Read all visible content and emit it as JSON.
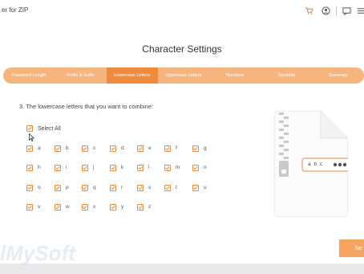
{
  "window": {
    "title": "er for ZIP"
  },
  "titlebar": {
    "icons": [
      "cart-icon",
      "user-icon",
      "feedback-icon",
      "menu-icon"
    ]
  },
  "heading": "Character Settings",
  "tabs": [
    {
      "label": "Password Length",
      "active": false
    },
    {
      "label": "Prefix & Suffix",
      "active": false
    },
    {
      "label": "Lowercase Letters",
      "active": true
    },
    {
      "label": "Uppercase Letters",
      "active": false
    },
    {
      "label": "Numbers",
      "active": false
    },
    {
      "label": "Symbols",
      "active": false
    },
    {
      "label": "Summary",
      "active": false
    }
  ],
  "question": "3. The lowercase letters that you want to combine:",
  "select_all": {
    "label": "Select All",
    "checked": true
  },
  "letters": [
    "a",
    "b",
    "c",
    "d",
    "e",
    "f",
    "g",
    "h",
    "i",
    "j",
    "k",
    "l",
    "m",
    "n",
    "o",
    "p",
    "q",
    "r",
    "s",
    "t",
    "u",
    "v",
    "w",
    "x",
    "y",
    "z"
  ],
  "illustration": {
    "password_text": "a b c"
  },
  "next_button": {
    "label": "Ne"
  },
  "watermark": "lMySoft",
  "colors": {
    "accent": "#f08a3e",
    "tab_bar": "#f6b57f"
  }
}
